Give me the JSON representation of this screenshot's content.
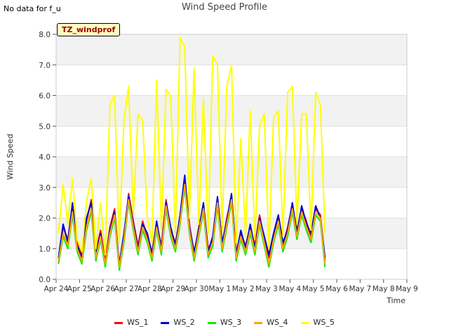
{
  "corner_note": "No data for f_u",
  "badge_label": "TZ_windprof",
  "chart_data": {
    "type": "line",
    "title": "Wind Speed Profile",
    "xlabel": "Time",
    "ylabel": "Wind Speed",
    "ylim": [
      0.0,
      8.0
    ],
    "yticks": [
      "0.0",
      "1.0",
      "2.0",
      "3.0",
      "4.0",
      "5.0",
      "6.0",
      "7.0",
      "8.0"
    ],
    "xlim_days": [
      0,
      15
    ],
    "xticks": [
      "Apr 24",
      "Apr 25",
      "Apr 26",
      "Apr 27",
      "Apr 28",
      "Apr 29",
      "Apr 30",
      "May 1",
      "May 2",
      "May 3",
      "May 4",
      "May 5",
      "May 6",
      "May 7",
      "May 8",
      "May 9"
    ],
    "x": [
      0.1,
      0.3,
      0.5,
      0.7,
      0.9,
      1.1,
      1.3,
      1.5,
      1.7,
      1.9,
      2.1,
      2.3,
      2.5,
      2.7,
      2.9,
      3.1,
      3.3,
      3.5,
      3.7,
      3.9,
      4.1,
      4.3,
      4.5,
      4.7,
      4.9,
      5.1,
      5.3,
      5.5,
      5.7,
      5.9,
      6.1,
      6.3,
      6.5,
      6.7,
      6.9,
      7.1,
      7.3,
      7.5,
      7.7,
      7.9,
      8.1,
      8.3,
      8.5,
      8.7,
      8.9,
      9.1,
      9.3,
      9.5,
      9.7,
      9.9,
      10.1,
      10.3,
      10.5,
      10.7,
      10.9,
      11.1,
      11.3,
      11.5,
      11.7,
      11.9,
      12.1,
      12.3,
      12.5,
      12.7,
      12.9,
      13.1,
      13.3,
      13.5,
      13.7,
      13.9,
      14.1
    ],
    "series": [
      {
        "name": "WS_1",
        "color": "#ff0000",
        "values": [
          0.6,
          1.7,
          1.3,
          2.4,
          1.2,
          0.8,
          1.9,
          2.6,
          0.9,
          1.6,
          0.6,
          1.7,
          2.3,
          0.4,
          1.4,
          2.8,
          1.9,
          1.1,
          1.9,
          1.4,
          0.9,
          1.8,
          1.1,
          2.6,
          1.6,
          1.2,
          2.0,
          3.3,
          1.8,
          0.8,
          1.7,
          2.4,
          1.0,
          1.3,
          2.6,
          1.1,
          2.0,
          2.7,
          0.9,
          1.5,
          1.1,
          1.7,
          1.1,
          2.1,
          1.3,
          0.7,
          1.4,
          2.0,
          1.1,
          1.7,
          2.4,
          1.6,
          2.3,
          1.9,
          1.4,
          2.3,
          2.1,
          0.6
        ]
      },
      {
        "name": "WS_2",
        "color": "#0000cc",
        "values": [
          0.7,
          1.8,
          1.2,
          2.5,
          1.1,
          0.7,
          2.0,
          2.5,
          0.8,
          1.5,
          0.5,
          1.6,
          2.2,
          0.5,
          1.5,
          2.7,
          1.8,
          1.0,
          1.8,
          1.5,
          0.8,
          1.9,
          1.0,
          2.5,
          1.7,
          1.1,
          2.1,
          3.4,
          1.7,
          0.9,
          1.6,
          2.5,
          0.9,
          1.4,
          2.7,
          1.2,
          1.9,
          2.8,
          0.8,
          1.6,
          1.0,
          1.8,
          1.0,
          2.0,
          1.4,
          0.8,
          1.5,
          2.1,
          1.2,
          1.6,
          2.5,
          1.5,
          2.4,
          1.8,
          1.5,
          2.4,
          2.0,
          0.7
        ]
      },
      {
        "name": "WS_3",
        "color": "#00ee00",
        "values": [
          0.5,
          1.4,
          1.0,
          2.1,
          0.9,
          0.5,
          1.6,
          2.2,
          0.6,
          1.3,
          0.4,
          1.4,
          2.0,
          0.3,
          1.2,
          2.5,
          1.6,
          0.8,
          1.6,
          1.2,
          0.6,
          1.6,
          0.8,
          2.3,
          1.4,
          0.9,
          1.8,
          3.0,
          1.5,
          0.6,
          1.4,
          2.2,
          0.7,
          1.1,
          2.4,
          0.9,
          1.7,
          2.5,
          0.6,
          1.3,
          0.8,
          1.5,
          0.8,
          1.8,
          1.1,
          0.4,
          1.2,
          1.8,
          0.9,
          1.4,
          2.2,
          1.3,
          2.1,
          1.6,
          1.2,
          2.1,
          1.9,
          0.4
        ]
      },
      {
        "name": "WS_4",
        "color": "#ffa500",
        "values": [
          0.6,
          1.5,
          1.1,
          2.2,
          1.0,
          0.6,
          1.7,
          2.3,
          0.7,
          1.4,
          0.5,
          1.5,
          2.1,
          0.4,
          1.3,
          2.6,
          1.7,
          0.9,
          1.7,
          1.3,
          0.7,
          1.7,
          0.9,
          2.4,
          1.5,
          1.0,
          1.9,
          3.1,
          1.6,
          0.7,
          1.5,
          2.3,
          0.8,
          1.2,
          2.5,
          1.0,
          1.8,
          2.6,
          0.7,
          1.4,
          0.9,
          1.6,
          0.9,
          1.9,
          1.2,
          0.5,
          1.3,
          1.9,
          1.0,
          1.5,
          2.3,
          1.4,
          2.2,
          1.7,
          1.3,
          2.2,
          2.0,
          0.5
        ]
      },
      {
        "name": "WS_5",
        "color": "#ffff00",
        "values": [
          1.5,
          3.1,
          1.8,
          3.3,
          1.3,
          0.9,
          2.5,
          3.3,
          1.0,
          2.5,
          0.8,
          5.7,
          6.0,
          1.2,
          5.2,
          6.3,
          2.1,
          5.4,
          5.2,
          2.0,
          1.2,
          6.5,
          1.6,
          6.2,
          6.0,
          1.5,
          7.9,
          7.6,
          2.0,
          6.9,
          1.8,
          5.9,
          1.5,
          7.3,
          7.0,
          1.6,
          6.3,
          7.0,
          1.2,
          4.6,
          1.4,
          5.5,
          1.3,
          5.0,
          5.4,
          1.0,
          5.3,
          5.5,
          1.4,
          6.1,
          6.3,
          1.8,
          5.4,
          5.4,
          1.6,
          6.1,
          5.7,
          1.5
        ]
      }
    ],
    "legend_position": "bottom"
  }
}
